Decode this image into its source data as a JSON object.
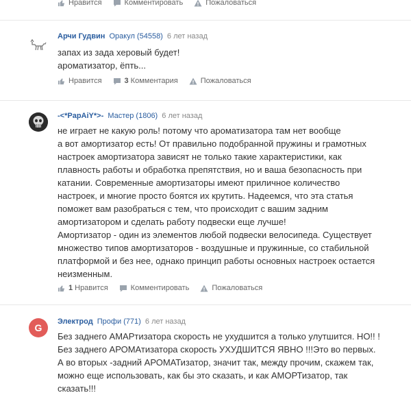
{
  "top_actions": {
    "like": "Нравится",
    "comment": "Комментировать",
    "report": "Пожаловаться"
  },
  "answers": [
    {
      "author": "Арчи Гудвин",
      "rank": "Оракул (54558)",
      "time": "6 лет назад",
      "lines": [
        "запах из зада херовый будет!",
        "ароматизатор, ёпть..."
      ],
      "like": "Нравится",
      "comments_count": "3",
      "comments_label": "Комментария",
      "report": "Пожаловаться"
    },
    {
      "author": "-<*PapAiY*>-",
      "rank": "Мастер (1806)",
      "time": "6 лет назад",
      "lines": [
        "не играет не какую роль! потому что ароматизатора там нет вообще",
        "а вот амортизатор есть! От правильно подобранной пружины и грамотных",
        "настроек амортизатора зависят не только такие характеристики, как",
        "плавность работы и обработка препятствия, но и ваша безопасность при",
        "катании. Современные амортизаторы имеют приличное количество",
        "настроек, и многие просто боятся их крутить. Надеемся, что эта статья",
        "поможет вам разобраться с тем, что происходит с вашим задним",
        "амортизатором и сделать работу подвески еще лучше!",
        "Амортизатор - один из элементов любой подвески велосипеда. Существует",
        "множество типов амортизаторов - воздушные и пружинные, со стабильной",
        "платформой и без нее, однако принцип работы основных настроек остается",
        "неизменным."
      ],
      "likes_count": "1",
      "like": "Нравится",
      "comment": "Комментировать",
      "report": "Пожаловаться"
    },
    {
      "author": "Электрод",
      "rank": "Профи (771)",
      "time": "6 лет назад",
      "avatar_letter": "G",
      "lines": [
        "Без заднего АМАРтизатора скорость не ухудшится а только улутшится. НО!! !",
        "Без заднего АРОМАтизатора скорость УХУДШИТСЯ ЯВНО !!!Это во первых.",
        "А во вторых -задний АРОМАТизатор, значит так, между прочим, скажем так,",
        "можно еще использовать, как бы это сказать, и как АМОРТизатор, так",
        "сказать!!!"
      ]
    }
  ],
  "colors": {
    "link": "#2a5d9f",
    "muted": "#888888",
    "avatar_g": "#e25c59"
  }
}
